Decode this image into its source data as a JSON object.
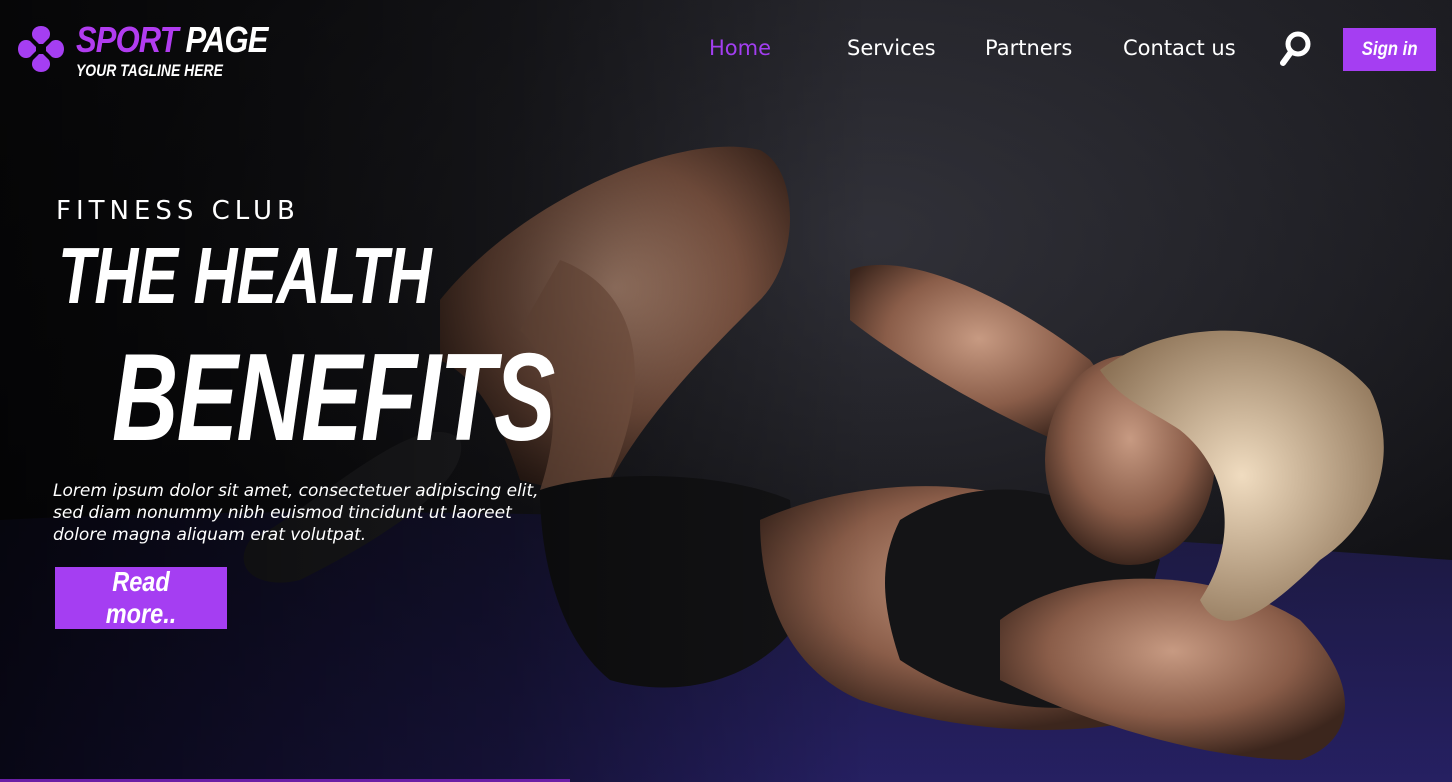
{
  "brand": {
    "title_part1": "SPORT",
    "title_part2": "PAGE",
    "tagline": "YOUR TAGLINE HERE",
    "accent_color": "#a53ef2"
  },
  "nav": {
    "items": [
      {
        "label": "Home",
        "active": true
      },
      {
        "label": "Services",
        "active": false
      },
      {
        "label": "Partners",
        "active": false
      },
      {
        "label": "Contact us",
        "active": false
      }
    ],
    "search_icon": "search-icon",
    "signin_label": "Sign in"
  },
  "hero": {
    "kicker": "FITNESS CLUB",
    "headline_line1": "THE HEALTH",
    "headline_line2": "BENEFITS",
    "body": "Lorem ipsum dolor sit amet, consectetuer adipiscing elit, sed diam nonummy nibh euismod tincidunt ut laoreet dolore magna aliquam erat volutpat.",
    "cta_label": "Read more.."
  }
}
